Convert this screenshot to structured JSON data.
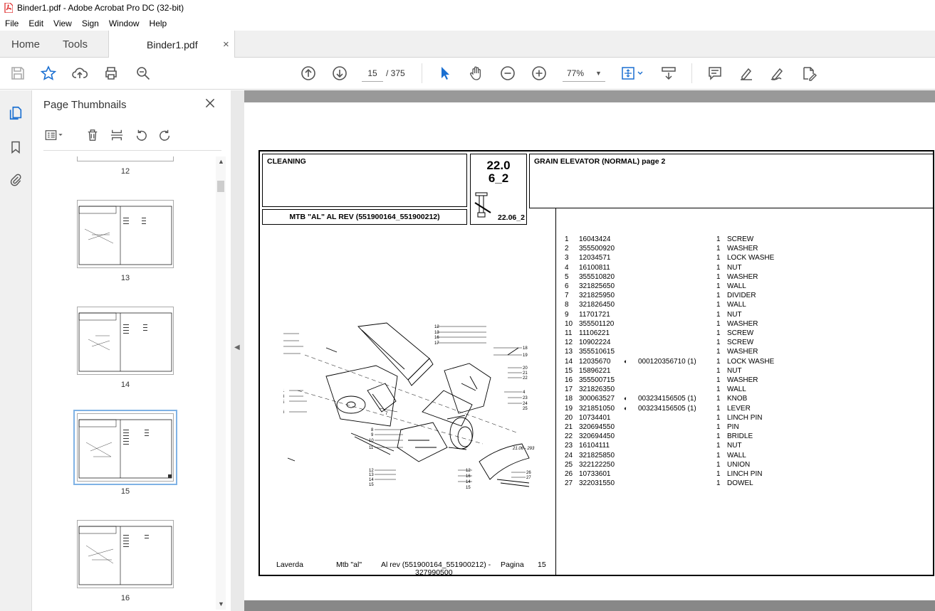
{
  "window": {
    "title": "Binder1.pdf - Adobe Acrobat Pro DC (32-bit)"
  },
  "menu": [
    "File",
    "Edit",
    "View",
    "Sign",
    "Window",
    "Help"
  ],
  "tabs": {
    "home": "Home",
    "tools": "Tools",
    "document": "Binder1.pdf",
    "close": "×"
  },
  "toolbar": {
    "page_current": "15",
    "page_total": "/  375",
    "zoom": "77%"
  },
  "panel": {
    "title": "Page Thumbnails",
    "pages": [
      "12",
      "13",
      "14",
      "15",
      "16"
    ],
    "selected": "15"
  },
  "page": {
    "section": "CLEANING",
    "code_line1": "22.0",
    "code_line2": "6_2",
    "code_small": "22.06_2",
    "model": "MTB \"AL\"  AL REV (551900164_551900212)",
    "group_title": "GRAIN ELEVATOR (NORMAL) page 2",
    "drawing_ref": "21.06 - 293",
    "footer_brand": "Laverda",
    "footer_model": "Mtb \"al\"",
    "footer_rev": "Al rev (551900164_551900212) -",
    "footer_code": "327990500",
    "footer_pagina": "Pagina",
    "footer_num": "15",
    "parts": [
      {
        "n": "1",
        "code": "16043424",
        "alt": "",
        "qty": "1",
        "desc": "SCREW"
      },
      {
        "n": "2",
        "code": "355500920",
        "alt": "",
        "qty": "1",
        "desc": "WASHER"
      },
      {
        "n": "3",
        "code": "12034571",
        "alt": "",
        "qty": "1",
        "desc": "LOCK WASHE"
      },
      {
        "n": "4",
        "code": "16100811",
        "alt": "",
        "qty": "1",
        "desc": "NUT"
      },
      {
        "n": "5",
        "code": "355510820",
        "alt": "",
        "qty": "1",
        "desc": "WASHER"
      },
      {
        "n": "6",
        "code": "321825650",
        "alt": "",
        "qty": "1",
        "desc": "WALL"
      },
      {
        "n": "7",
        "code": "321825950",
        "alt": "",
        "qty": "1",
        "desc": "DIVIDER"
      },
      {
        "n": "8",
        "code": "321826450",
        "alt": "",
        "qty": "1",
        "desc": "WALL"
      },
      {
        "n": "9",
        "code": "11701721",
        "alt": "",
        "qty": "1",
        "desc": "NUT"
      },
      {
        "n": "10",
        "code": "355501120",
        "alt": "",
        "qty": "1",
        "desc": "WASHER"
      },
      {
        "n": "11",
        "code": "11106221",
        "alt": "",
        "qty": "1",
        "desc": "SCREW"
      },
      {
        "n": "12",
        "code": "10902224",
        "alt": "",
        "qty": "1",
        "desc": "SCREW"
      },
      {
        "n": "13",
        "code": "355510615",
        "alt": "",
        "qty": "1",
        "desc": "WASHER"
      },
      {
        "n": "14",
        "code": "12035670",
        "alt": "000120356710  (1)",
        "qty": "1",
        "desc": "LOCK WASHE"
      },
      {
        "n": "15",
        "code": "15896221",
        "alt": "",
        "qty": "1",
        "desc": "NUT"
      },
      {
        "n": "16",
        "code": "355500715",
        "alt": "",
        "qty": "1",
        "desc": "WASHER"
      },
      {
        "n": "17",
        "code": "321826350",
        "alt": "",
        "qty": "1",
        "desc": "WALL"
      },
      {
        "n": "18",
        "code": "300063527",
        "alt": "003234156505  (1)",
        "qty": "1",
        "desc": "KNOB"
      },
      {
        "n": "19",
        "code": "321851050",
        "alt": "003234156505  (1)",
        "qty": "1",
        "desc": "LEVER"
      },
      {
        "n": "20",
        "code": "10734401",
        "alt": "",
        "qty": "1",
        "desc": "LINCH PIN"
      },
      {
        "n": "21",
        "code": "320694550",
        "alt": "",
        "qty": "1",
        "desc": "PIN"
      },
      {
        "n": "22",
        "code": "320694450",
        "alt": "",
        "qty": "1",
        "desc": "BRIDLE"
      },
      {
        "n": "23",
        "code": "16104111",
        "alt": "",
        "qty": "1",
        "desc": "NUT"
      },
      {
        "n": "24",
        "code": "321825850",
        "alt": "",
        "qty": "1",
        "desc": "WALL"
      },
      {
        "n": "25",
        "code": "322122250",
        "alt": "",
        "qty": "1",
        "desc": "UNION"
      },
      {
        "n": "26",
        "code": "10733601",
        "alt": "",
        "qty": "1",
        "desc": "LINCH PIN"
      },
      {
        "n": "27",
        "code": "322031550",
        "alt": "",
        "qty": "1",
        "desc": "DOWEL"
      }
    ]
  },
  "colors": {
    "accent": "#1a6fd1",
    "tab_bg": "#f0f0f0",
    "selection": "#7fb2e5"
  }
}
